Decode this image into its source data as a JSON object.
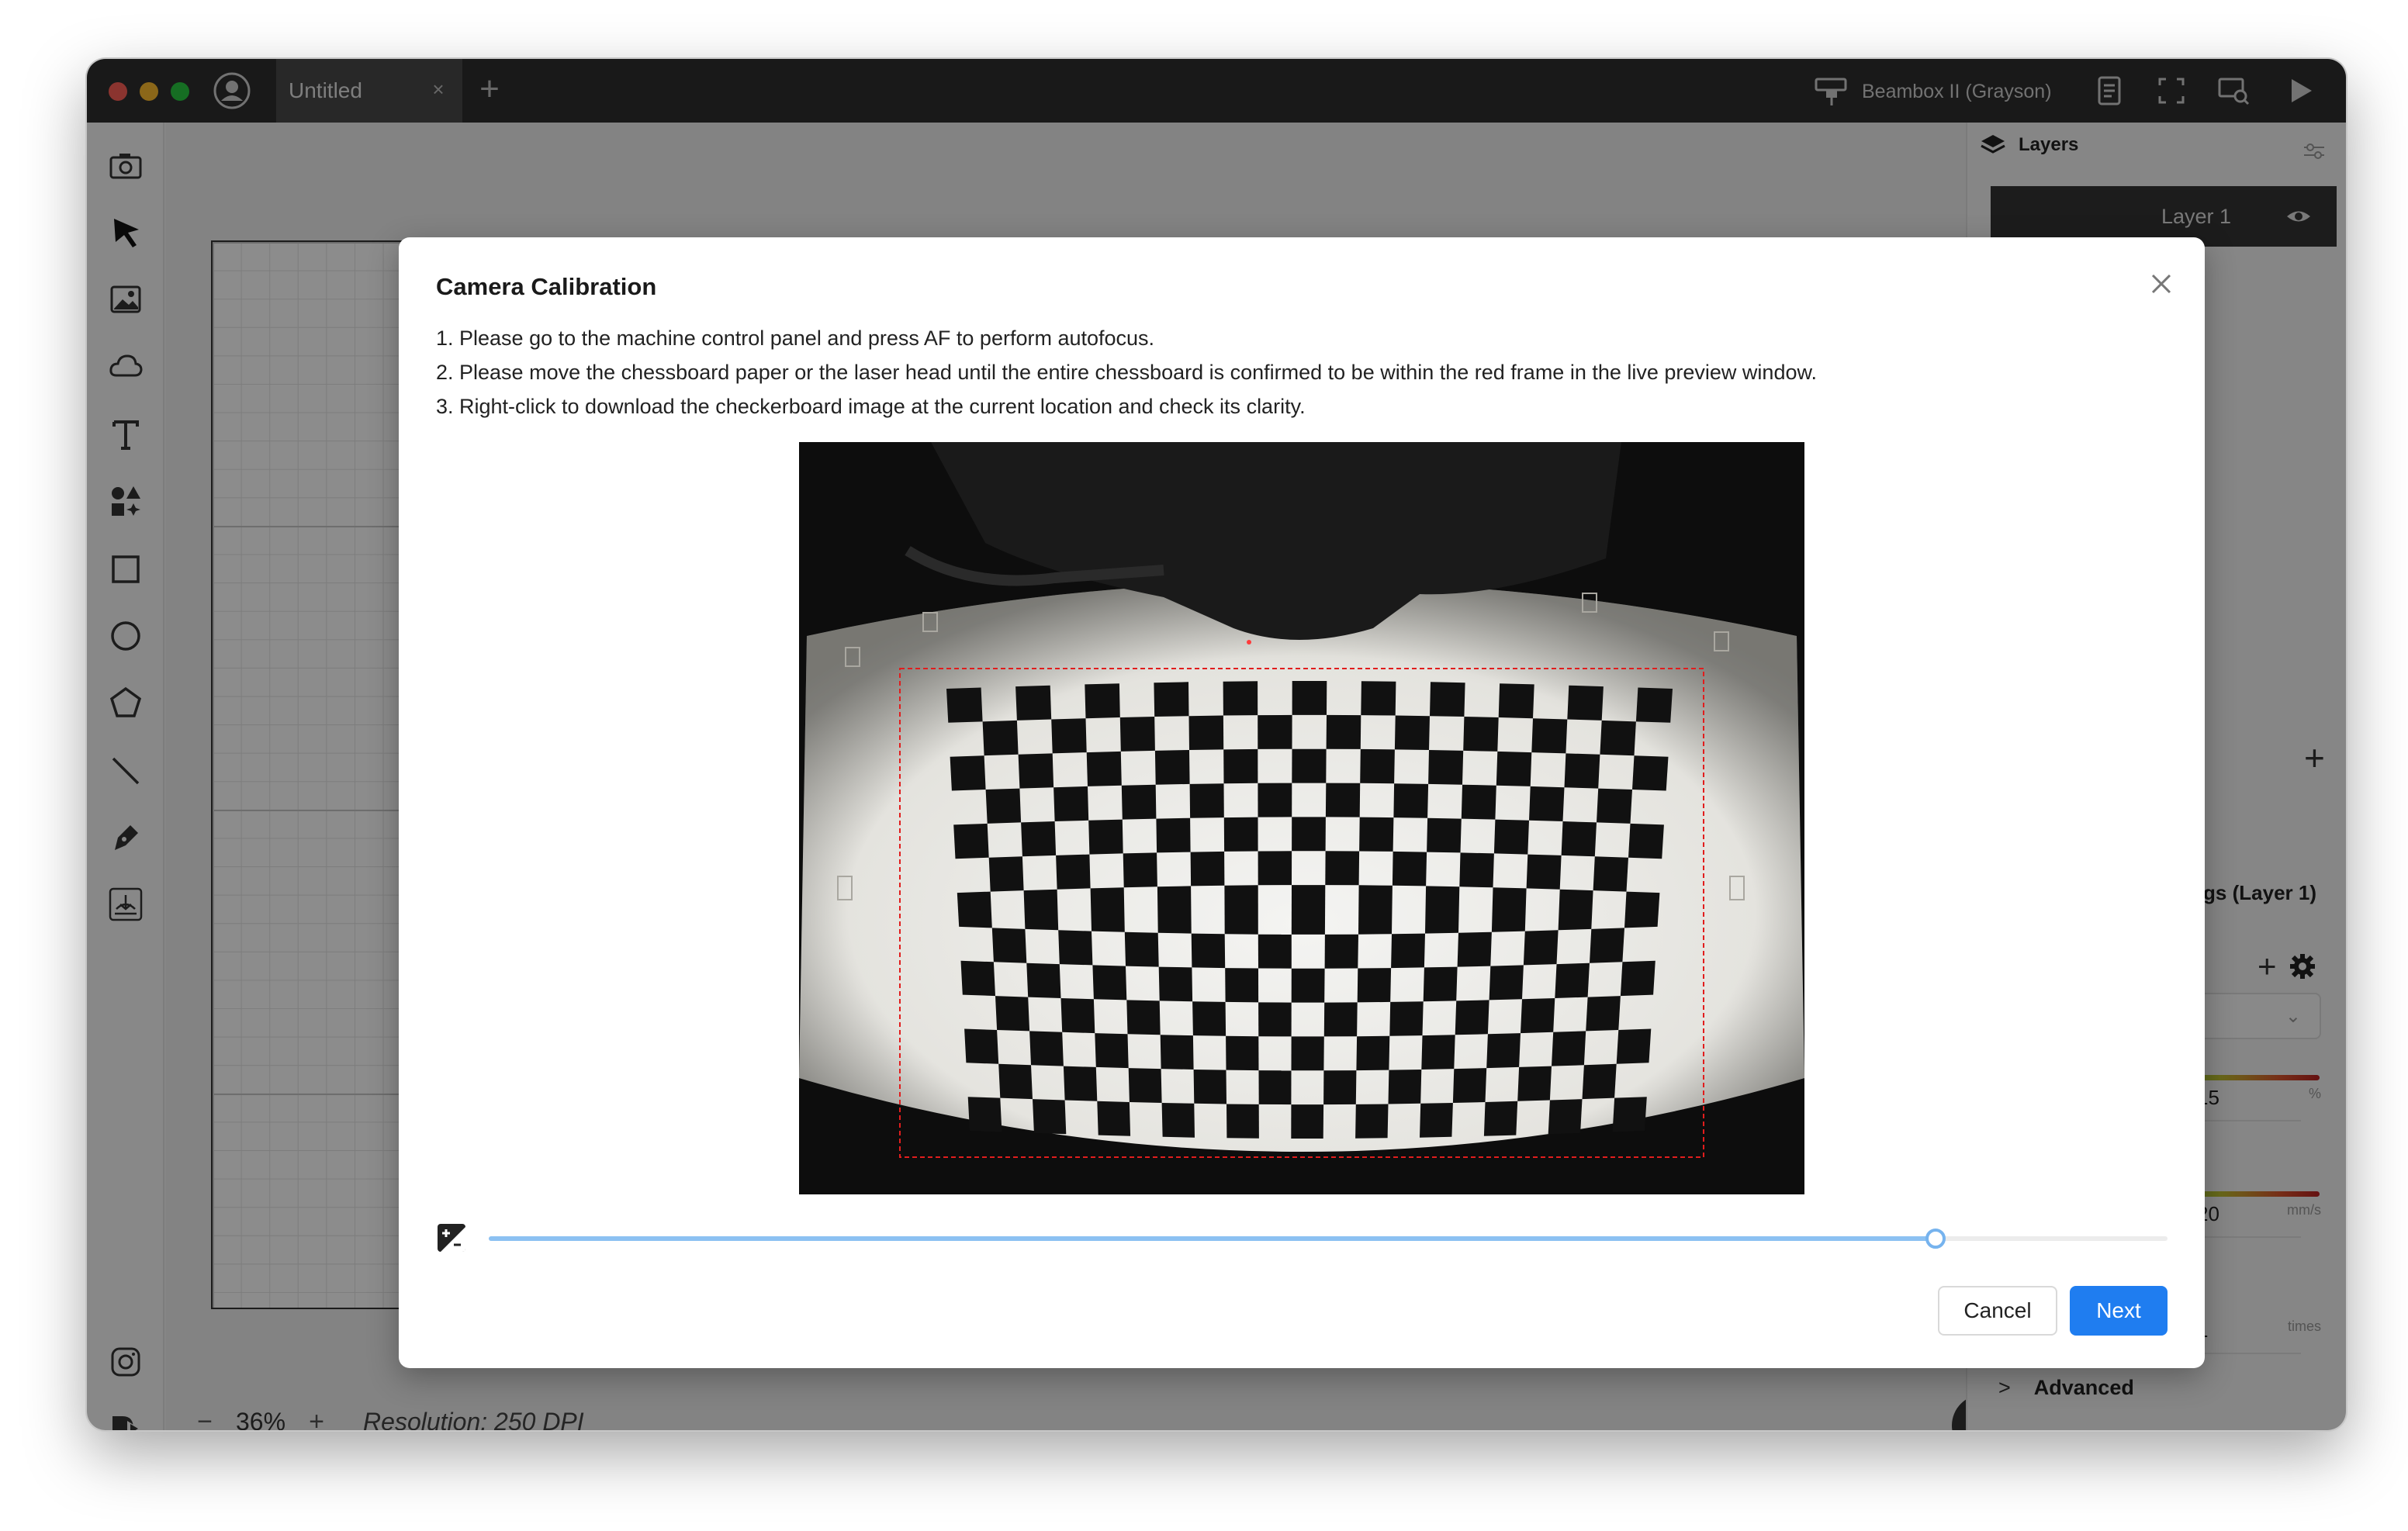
{
  "titlebar": {
    "tab_title": "Untitled",
    "tab_close": "×",
    "tab_add": "+",
    "machine_name": "Beambox II (Grayson)"
  },
  "left_tools": [
    "camera-icon",
    "select-arrow-icon",
    "image-icon",
    "cloud-icon",
    "text-icon",
    "elements-icon",
    "rectangle-icon",
    "ellipse-icon",
    "polygon-icon",
    "line-icon",
    "pen-icon",
    "design-market-icon",
    "instagram-icon",
    "dmkt-icon"
  ],
  "canvas": {
    "zoom_minus": "−",
    "zoom_value": "36%",
    "zoom_plus": "+",
    "resolution": "Resolution: 250 DPI"
  },
  "right_panel": {
    "layers_title": "Layers",
    "layer_name": "Layer 1",
    "layer_add": "+",
    "settings_title": "ettings (Layer 1)",
    "preset_add": "+",
    "power": {
      "value": "15",
      "unit": "%",
      "fraction": 0.15
    },
    "speed": {
      "value": "20",
      "unit": "mm/s",
      "fraction": 0.2
    },
    "repeat": {
      "value": "1",
      "unit": "times"
    },
    "advanced_label": "Advanced",
    "advanced_chevron": ">"
  },
  "modal": {
    "title": "Camera Calibration",
    "steps": [
      "1. Please go to the machine control panel and press AF to perform autofocus.",
      "2. Please move the chessboard paper or the laser head until the entire chessboard is confirmed to be within the red frame in the live preview window.",
      "3. Right-click to download the checkerboard image at the current location and check its clarity."
    ],
    "exposure_fraction": 0.862,
    "cancel_label": "Cancel",
    "next_label": "Next"
  },
  "colors": {
    "accent": "#1f7df0",
    "slider": "#8cc1f2",
    "red_frame": "#e11d1d"
  }
}
